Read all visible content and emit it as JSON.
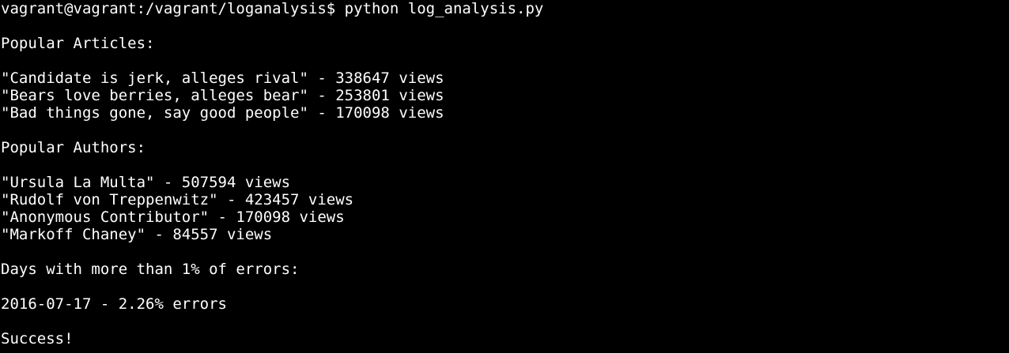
{
  "terminal": {
    "prompt": "vagrant@vagrant:/vagrant/loganalysis$ python log_analysis.py",
    "articles_heading": "Popular Articles:",
    "articles": [
      "\"Candidate is jerk, alleges rival\" - 338647 views",
      "\"Bears love berries, alleges bear\" - 253801 views",
      "\"Bad things gone, say good people\" - 170098 views"
    ],
    "authors_heading": "Popular Authors:",
    "authors": [
      "\"Ursula La Multa\" - 507594 views",
      "\"Rudolf von Treppenwitz\" - 423457 views",
      "\"Anonymous Contributor\" - 170098 views",
      "\"Markoff Chaney\" - 84557 views"
    ],
    "errors_heading": "Days with more than 1% of errors:",
    "errors": [
      "2016-07-17 - 2.26% errors"
    ],
    "final_status": "Success!"
  },
  "colors": {
    "background": "#000000",
    "text": "#ffffff"
  }
}
